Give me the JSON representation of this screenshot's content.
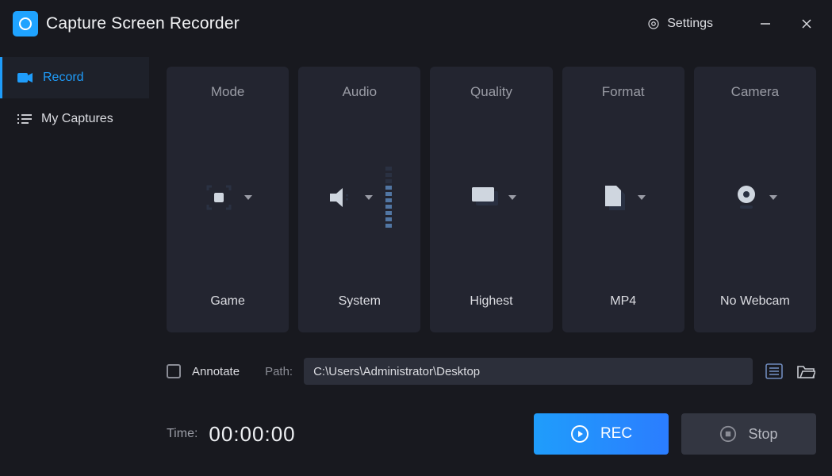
{
  "app": {
    "title": "Capture Screen Recorder"
  },
  "titlebar": {
    "settings": "Settings"
  },
  "sidebar": {
    "items": [
      {
        "label": "Record"
      },
      {
        "label": "My Captures"
      }
    ]
  },
  "cards": {
    "mode": {
      "title": "Mode",
      "value": "Game"
    },
    "audio": {
      "title": "Audio",
      "value": "System"
    },
    "quality": {
      "title": "Quality",
      "value": "Highest"
    },
    "format": {
      "title": "Format",
      "value": "MP4"
    },
    "camera": {
      "title": "Camera",
      "value": "No Webcam"
    }
  },
  "annotate": {
    "label": "Annotate",
    "checked": false
  },
  "path": {
    "label": "Path:",
    "value": "C:\\Users\\Administrator\\Desktop"
  },
  "time": {
    "label": "Time:",
    "value": "00:00:00"
  },
  "buttons": {
    "rec": "REC",
    "stop": "Stop"
  }
}
